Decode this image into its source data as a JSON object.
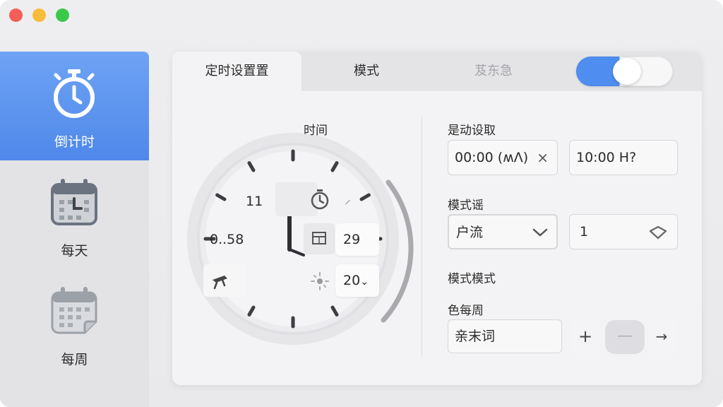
{
  "sidebar": {
    "items": [
      {
        "label": "倒计时",
        "icon": "stopwatch-icon",
        "active": true
      },
      {
        "label": "每天",
        "icon": "calendar-day-icon",
        "active": false
      },
      {
        "label": "每周",
        "icon": "calendar-week-icon",
        "active": false
      }
    ]
  },
  "tabs": [
    {
      "label": "定时设置置",
      "active": true
    },
    {
      "label": "模式",
      "active": false
    },
    {
      "label": "芨东急",
      "active": false,
      "disabled": true
    }
  ],
  "toggle": {
    "on": true
  },
  "clock": {
    "title": "时间",
    "hour_label": "11",
    "left_value": "0..58",
    "box1_value": "29",
    "box2_value": "20",
    "box2_chevron": "⌄"
  },
  "right": {
    "section1_label": "是动设取",
    "start_time": "00:00 (ʍΛ)",
    "start_clear": "×",
    "end_time": "10:00 H?",
    "section2_label": "模式谣",
    "mode_select": "户流",
    "count_value": "1",
    "section3_label": "模式模式",
    "section4_label": "色每周",
    "name_field": "亲末词",
    "plus_label": "+",
    "minus_label": "—",
    "arrow_label": "→"
  },
  "colors": {
    "accent": "#4f88ea",
    "toggle_on": "#4f8ef0"
  }
}
